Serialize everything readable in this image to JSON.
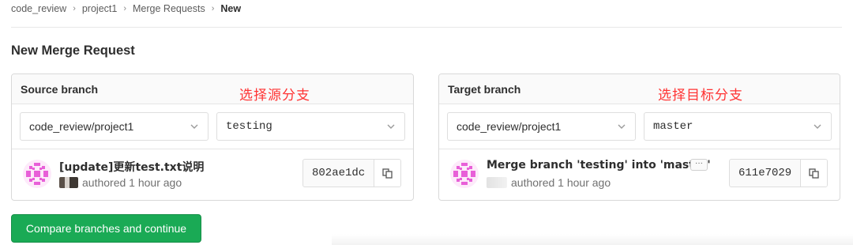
{
  "breadcrumb": {
    "items": [
      "code_review",
      "project1",
      "Merge Requests"
    ],
    "current": "New"
  },
  "page_title": "New Merge Request",
  "source": {
    "header": "Source branch",
    "annotation": "选择源分支",
    "project_value": "code_review/project1",
    "branch_value": "testing",
    "commit": {
      "title": "[update]更新test.txt说明",
      "meta": "authored 1 hour ago",
      "sha": "802ae1dc"
    }
  },
  "target": {
    "header": "Target branch",
    "annotation": "选择目标分支",
    "project_value": "code_review/project1",
    "branch_value": "master",
    "commit": {
      "title": "Merge branch 'testing' into 'master'",
      "ellipsis": "···",
      "meta": "authored 1 hour ago",
      "sha": "611e7029"
    }
  },
  "compare_button": "Compare branches and continue",
  "icons": {
    "chevron": "chevron-down-icon",
    "copy": "copy-icon",
    "avatar": "identicon-avatar"
  },
  "colors": {
    "accent_green": "#1aaa55",
    "annotation_red": "#ff3333",
    "avatar_pink": "#e85fd8"
  }
}
